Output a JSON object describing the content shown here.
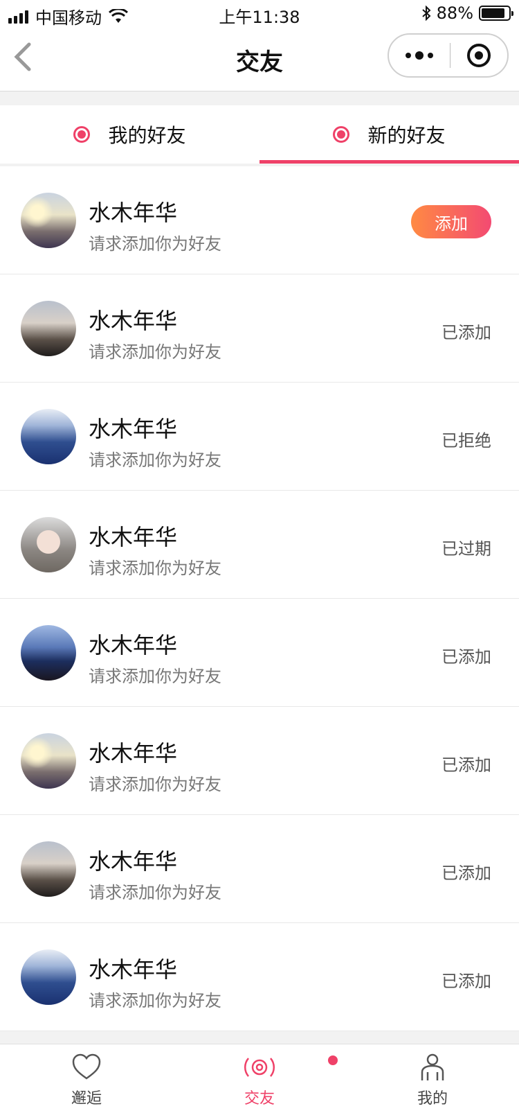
{
  "status_bar": {
    "carrier": "中国移动",
    "time": "上午11:38",
    "battery_pct": "88%"
  },
  "nav": {
    "title": "交友"
  },
  "tabs": [
    {
      "label": "我的好友",
      "active": false
    },
    {
      "label": "新的好友",
      "active": true
    }
  ],
  "requests": [
    {
      "name": "水木年华",
      "subtitle": "请求添加你为好友",
      "action": "添加",
      "avatar": "sunset"
    },
    {
      "name": "水木年华",
      "subtitle": "请求添加你为好友",
      "status": "已添加",
      "avatar": "cliff"
    },
    {
      "name": "水木年华",
      "subtitle": "请求添加你为好友",
      "status": "已拒绝",
      "avatar": "pool"
    },
    {
      "name": "水木年华",
      "subtitle": "请求添加你为好友",
      "status": "已过期",
      "avatar": "portrait"
    },
    {
      "name": "水木年华",
      "subtitle": "请求添加你为好友",
      "status": "已添加",
      "avatar": "sea"
    },
    {
      "name": "水木年华",
      "subtitle": "请求添加你为好友",
      "status": "已添加",
      "avatar": "sunset"
    },
    {
      "name": "水木年华",
      "subtitle": "请求添加你为好友",
      "status": "已添加",
      "avatar": "cliff"
    },
    {
      "name": "水木年华",
      "subtitle": "请求添加你为好友",
      "status": "已添加",
      "avatar": "pool"
    }
  ],
  "bottom_nav": [
    {
      "label": "邂逅",
      "icon": "heart-icon",
      "active": false
    },
    {
      "label": "交友",
      "icon": "radio-waves-icon",
      "active": true,
      "badge": true
    },
    {
      "label": "我的",
      "icon": "person-icon",
      "active": false
    }
  ],
  "colors": {
    "accent": "#ef4168",
    "button_gradient_start": "#ff8a43",
    "button_gradient_end": "#f34a72"
  }
}
